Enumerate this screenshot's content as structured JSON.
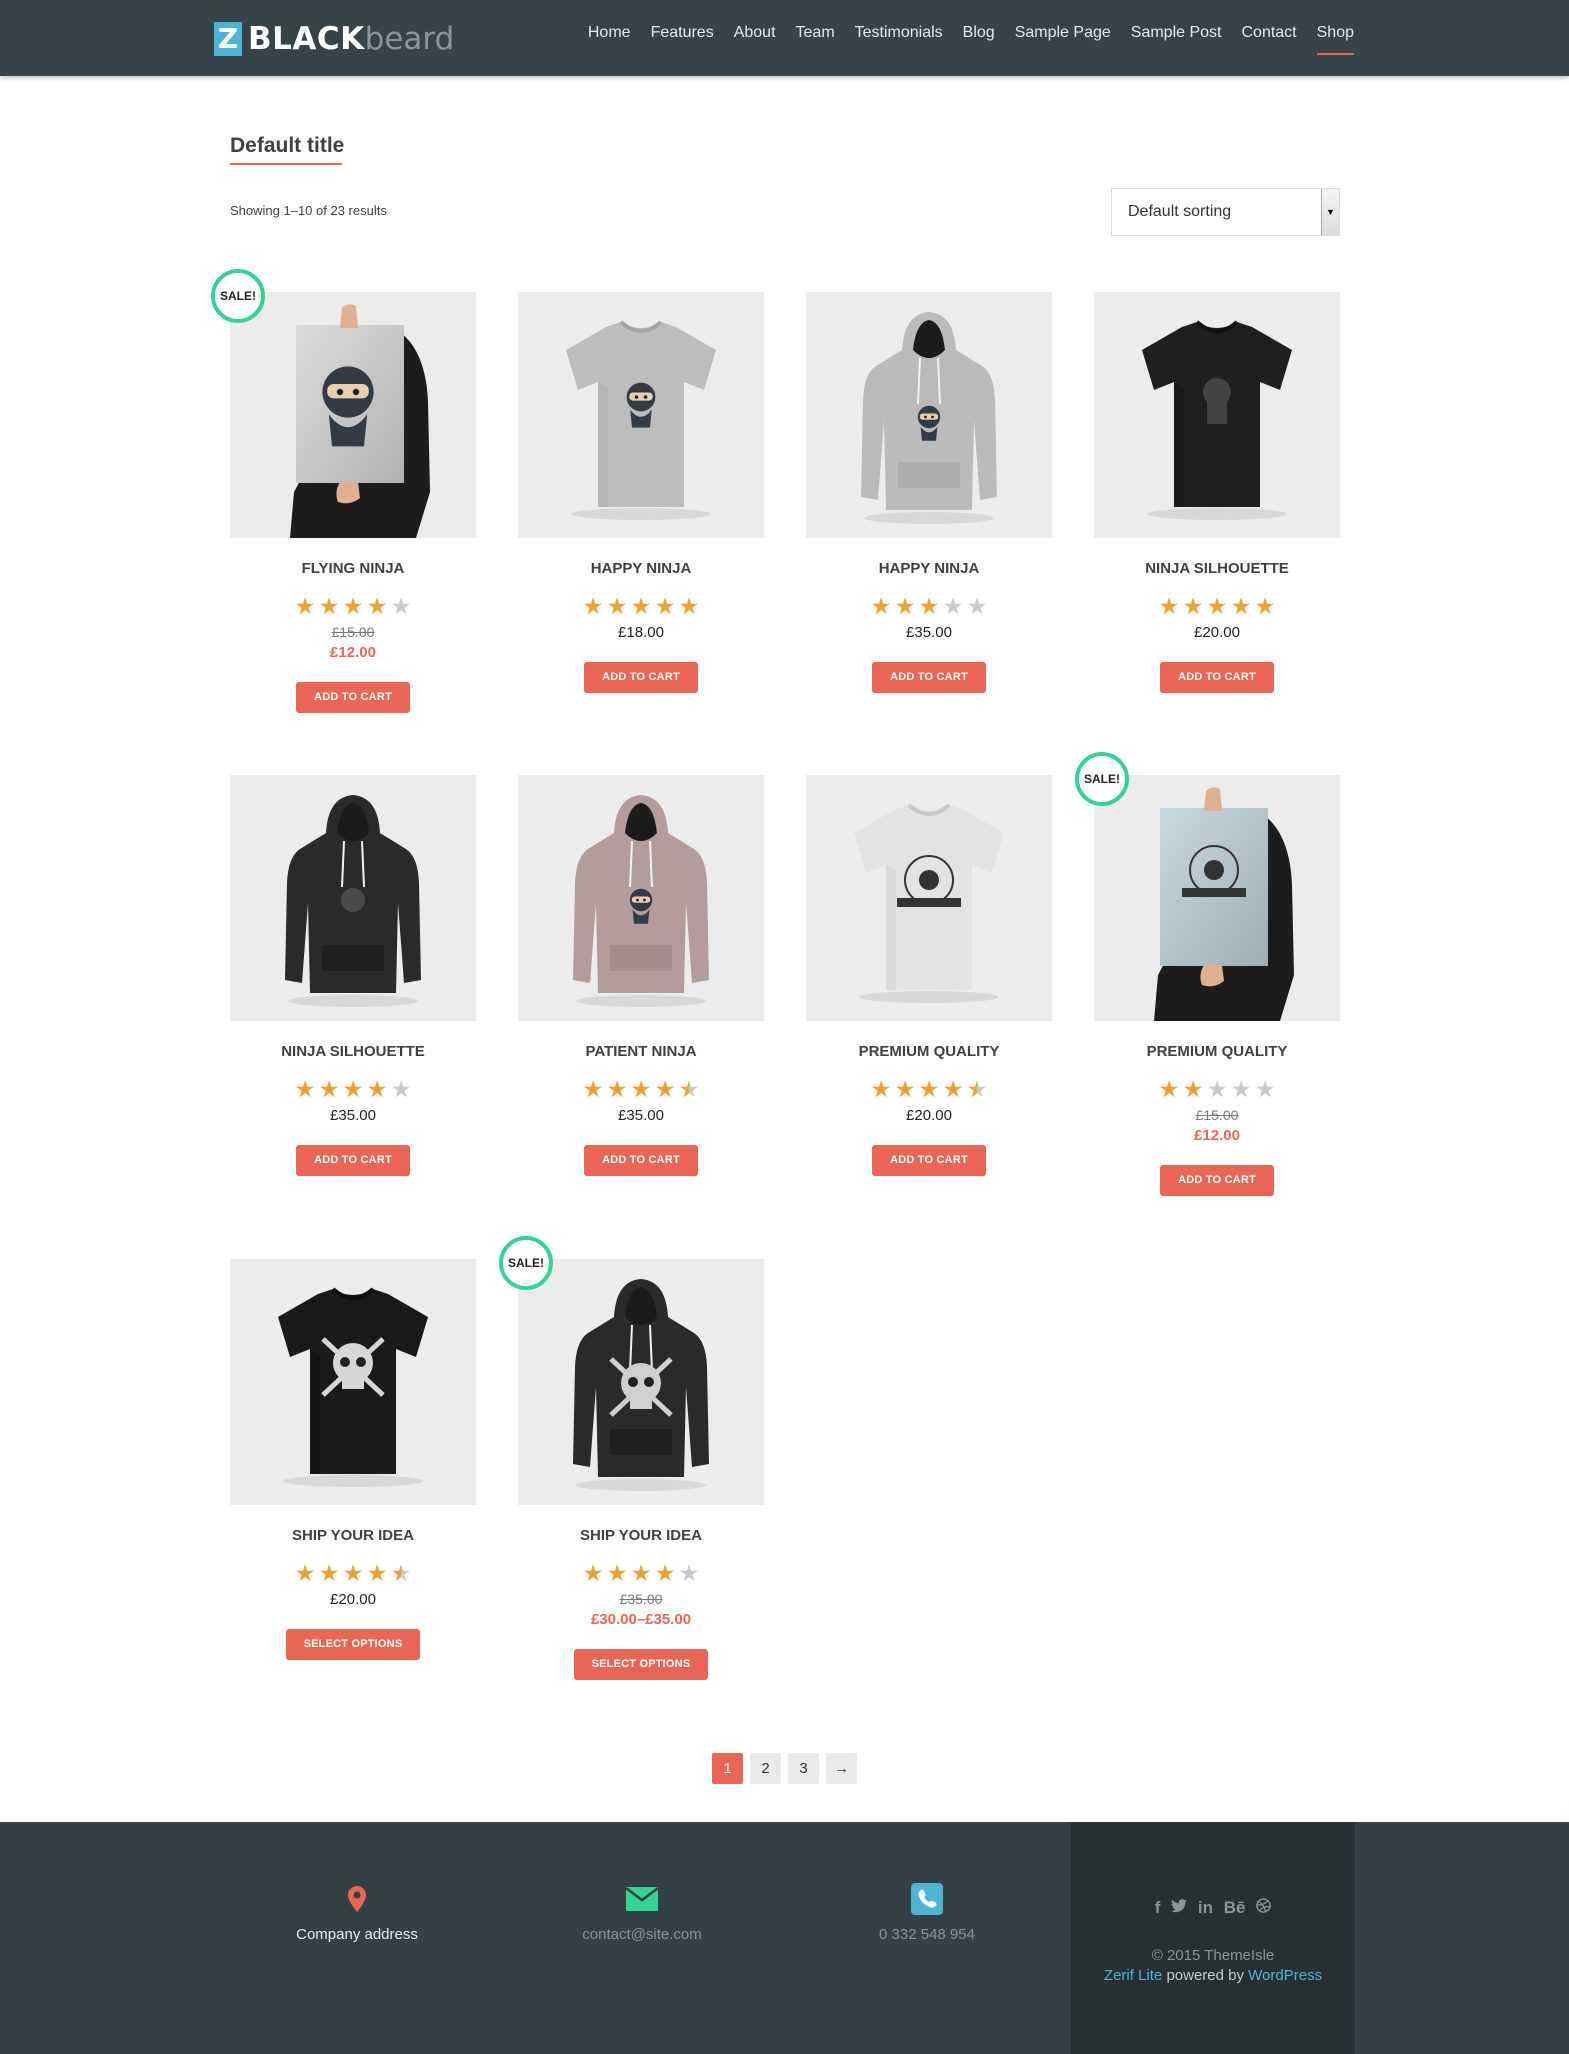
{
  "header": {
    "logo_mark": "Z",
    "logo_bold": "BLACK",
    "logo_light": "beard",
    "nav": [
      "Home",
      "Features",
      "About",
      "Team",
      "Testimonials",
      "Blog",
      "Sample Page",
      "Sample Post",
      "Contact",
      "Shop"
    ],
    "active_nav": "Shop"
  },
  "page": {
    "title": "Default title",
    "result_count": "Showing 1–10 of 23 results",
    "sorting": "Default sorting"
  },
  "sale_label": "SALE!",
  "products": [
    {
      "name": "Flying Ninja",
      "rating": 4,
      "price": "",
      "old_price": "£15.00",
      "sale_price": "£12.00",
      "button": "Add to cart",
      "sale": true,
      "image": "poster-ninja"
    },
    {
      "name": "Happy Ninja",
      "rating": 5,
      "price": "£18.00",
      "old_price": "",
      "sale_price": "",
      "button": "Add to cart",
      "sale": false,
      "image": "tshirt-grey"
    },
    {
      "name": "Happy Ninja",
      "rating": 3,
      "price": "£35.00",
      "old_price": "",
      "sale_price": "",
      "button": "Add to cart",
      "sale": false,
      "image": "hoodie-grey"
    },
    {
      "name": "Ninja Silhouette",
      "rating": 5,
      "price": "£20.00",
      "old_price": "",
      "sale_price": "",
      "button": "Add to cart",
      "sale": false,
      "image": "tshirt-black"
    },
    {
      "name": "Ninja Silhouette",
      "rating": 4,
      "price": "£35.00",
      "old_price": "",
      "sale_price": "",
      "button": "Add to cart",
      "sale": false,
      "image": "hoodie-black"
    },
    {
      "name": "Patient Ninja",
      "rating": 4.5,
      "price": "£35.00",
      "old_price": "",
      "sale_price": "",
      "button": "Add to cart",
      "sale": false,
      "image": "hoodie-pink"
    },
    {
      "name": "Premium Quality",
      "rating": 4.5,
      "price": "£20.00",
      "old_price": "",
      "sale_price": "",
      "button": "Add to cart",
      "sale": false,
      "image": "tshirt-white"
    },
    {
      "name": "Premium Quality",
      "rating": 2,
      "price": "",
      "old_price": "£15.00",
      "sale_price": "£12.00",
      "button": "Add to cart",
      "sale": true,
      "image": "poster-blue"
    },
    {
      "name": "Ship Your Idea",
      "rating": 4.5,
      "price": "£20.00",
      "old_price": "",
      "sale_price": "",
      "button": "Select options",
      "sale": false,
      "image": "tshirt-skull"
    },
    {
      "name": "Ship Your Idea",
      "rating": 4,
      "price": "",
      "old_price": "£35.00",
      "sale_price": "£30.00–£35.00",
      "button": "Select options",
      "sale": true,
      "image": "hoodie-skull"
    }
  ],
  "pagination": {
    "pages": [
      "1",
      "2",
      "3"
    ],
    "next": "→",
    "current": "1"
  },
  "footer": {
    "address": "Company address",
    "email": "contact@site.com",
    "phone": "0 332 548 954",
    "social": [
      "f",
      "t",
      "in",
      "Bē",
      "dribbble"
    ],
    "copyright": "© 2015 ThemeIsle",
    "theme_link": "Zerif Lite",
    "powered_by": "powered by",
    "wp_link": "WordPress",
    "colors": {
      "pin": "#e96656",
      "mail": "#34d293",
      "phone": "#4eb4d6"
    }
  },
  "colors": {
    "accent": "#e96656",
    "header_bg": "#364348",
    "footer_bg": "#334146",
    "sale_ring": "#34d293",
    "star": "#e8a332"
  }
}
